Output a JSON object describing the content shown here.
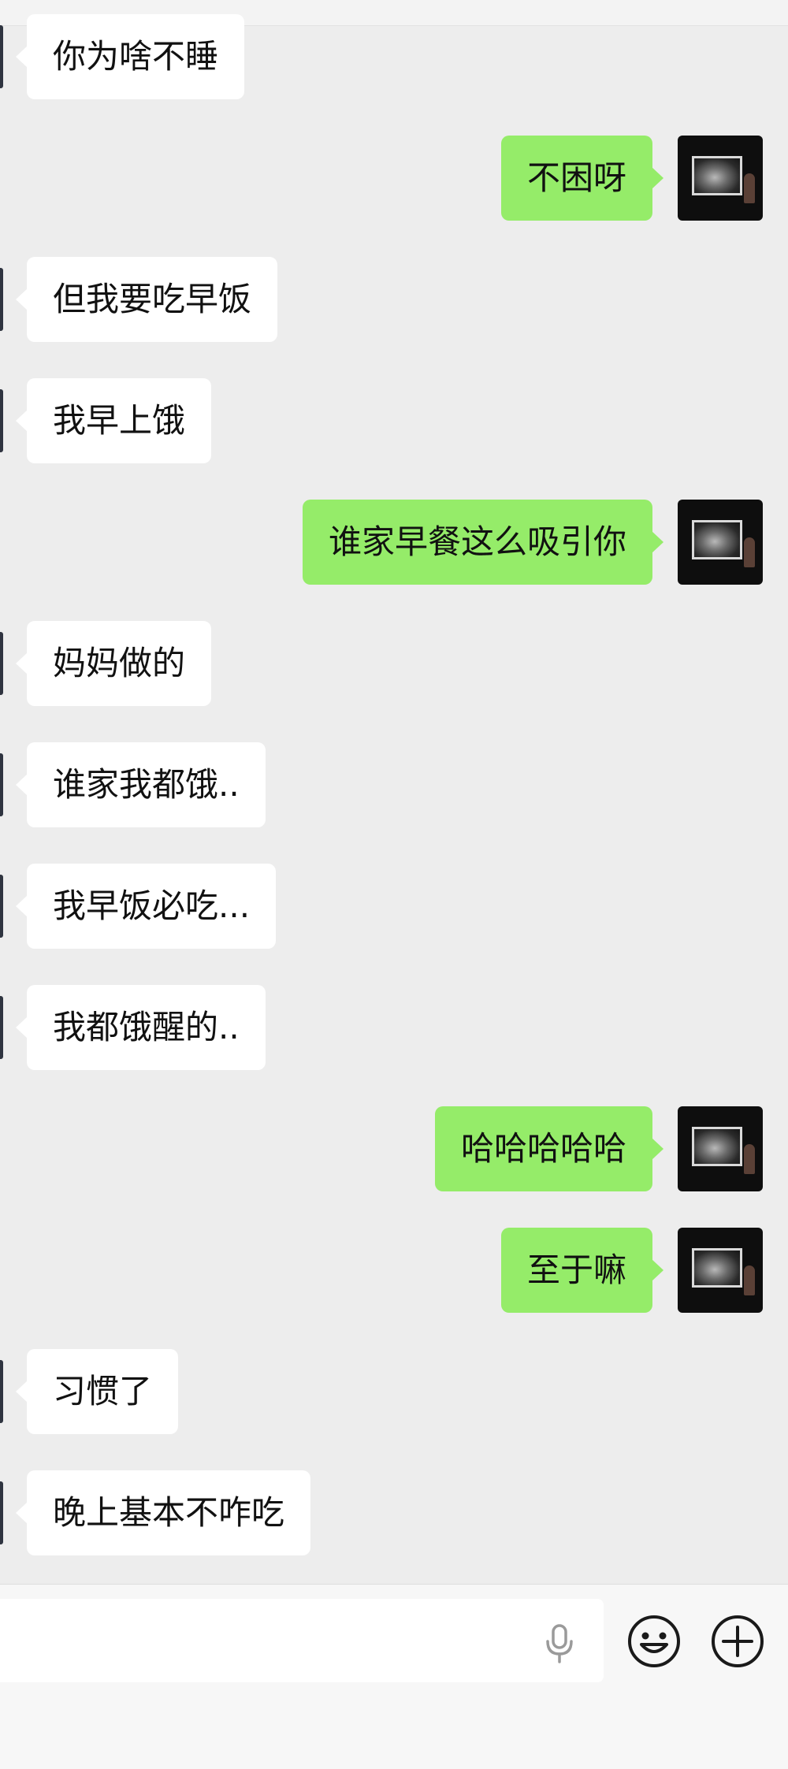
{
  "messages": [
    {
      "dir": "in",
      "text": "你为啥不睡"
    },
    {
      "dir": "out",
      "text": "不困呀"
    },
    {
      "dir": "in",
      "text": "但我要吃早饭"
    },
    {
      "dir": "in",
      "text": "我早上饿"
    },
    {
      "dir": "out",
      "text": "谁家早餐这么吸引你"
    },
    {
      "dir": "in",
      "text": "妈妈做的"
    },
    {
      "dir": "in",
      "text": "谁家我都饿.."
    },
    {
      "dir": "in",
      "text": "我早饭必吃..."
    },
    {
      "dir": "in",
      "text": "我都饿醒的.."
    },
    {
      "dir": "out",
      "text": "哈哈哈哈哈"
    },
    {
      "dir": "out",
      "text": "至于嘛"
    },
    {
      "dir": "in",
      "text": "习惯了"
    },
    {
      "dir": "in",
      "text": "晚上基本不咋吃"
    }
  ],
  "input_bar": {
    "placeholder": "",
    "voice_icon": "microphone-icon",
    "emoji_icon": "smiley-face-icon",
    "more_icon": "plus-circle-icon"
  },
  "colors": {
    "background": "#ededed",
    "incoming_bubble": "#ffffff",
    "outgoing_bubble": "#95ec69"
  }
}
